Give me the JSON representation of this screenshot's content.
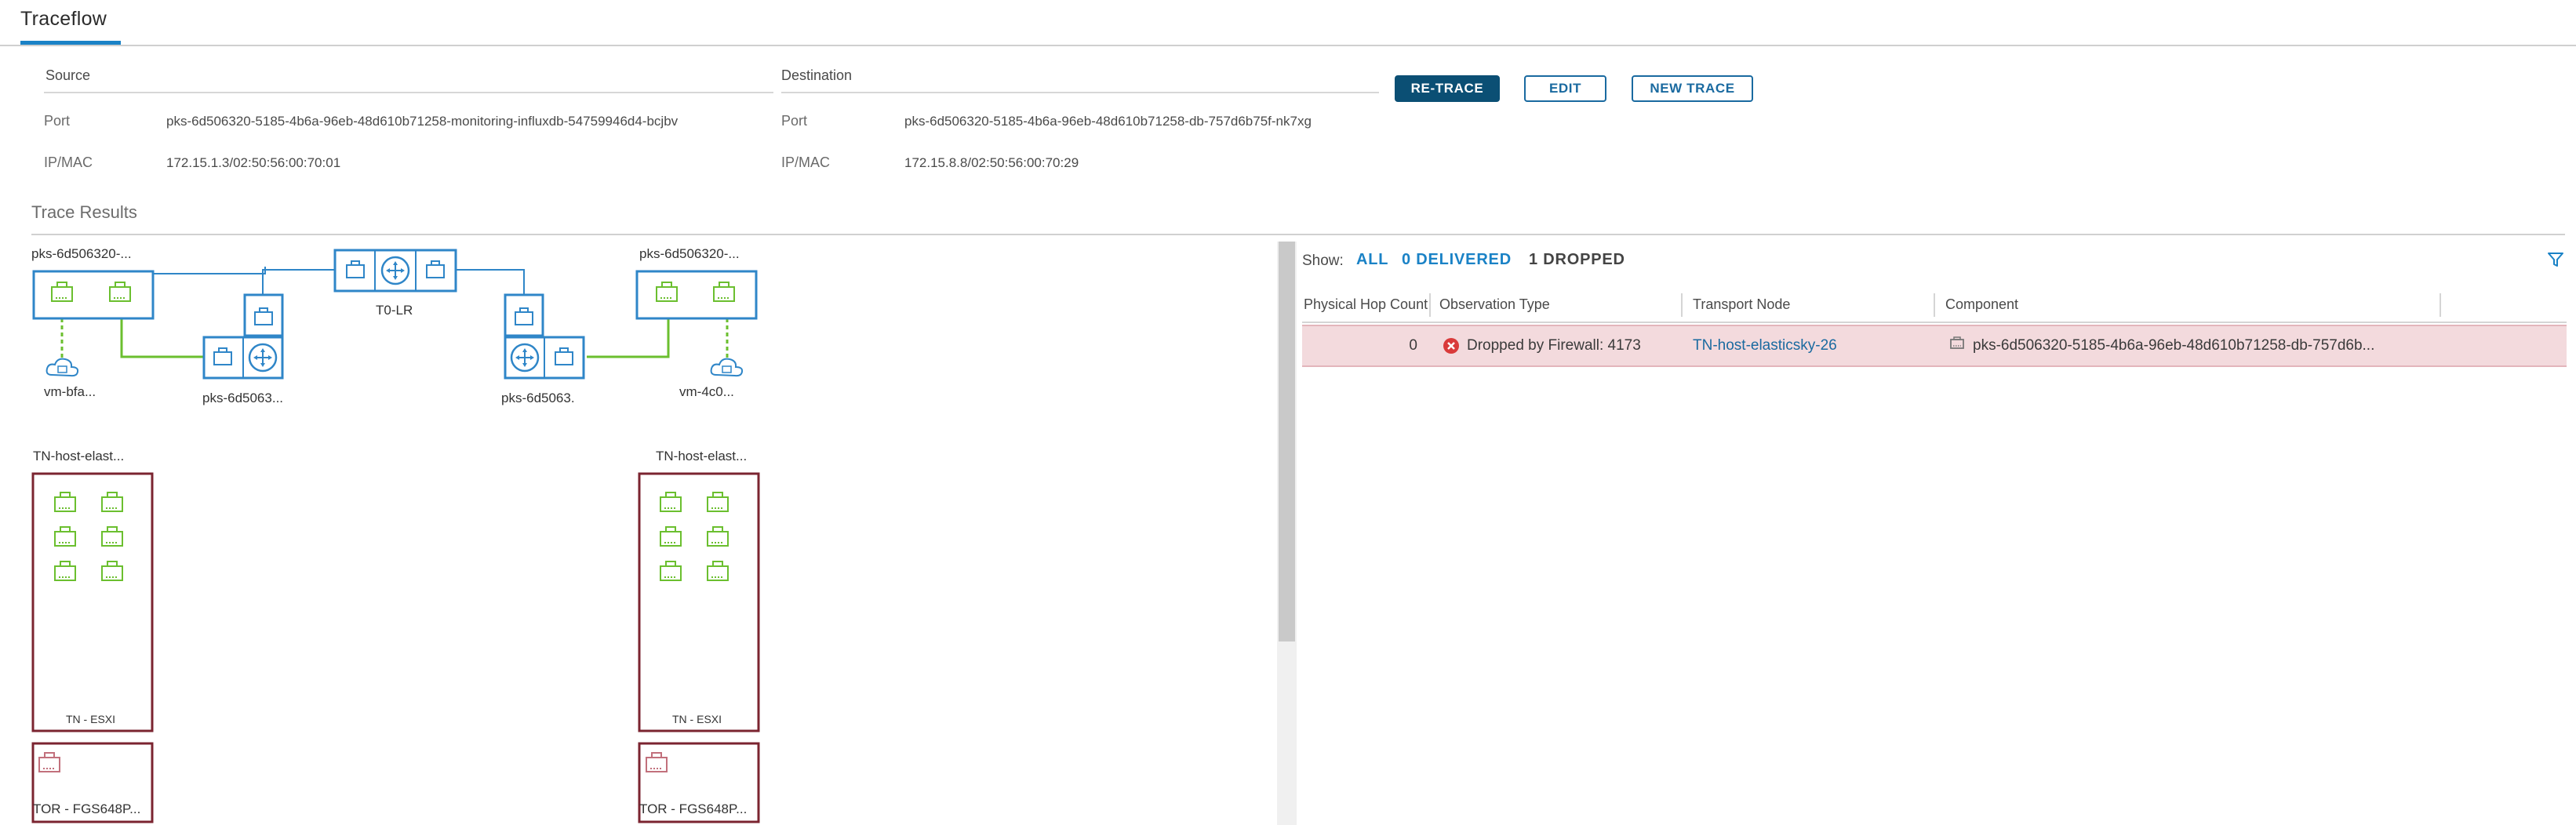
{
  "header": {
    "title": "Traceflow"
  },
  "source": {
    "section_label": "Source",
    "port_label": "Port",
    "port_value": "pks-6d506320-5185-4b6a-96eb-48d610b71258-monitoring-influxdb-54759946d4-bcjbv",
    "ipmac_label": "IP/MAC",
    "ipmac_value": "172.15.1.3/02:50:56:00:70:01"
  },
  "destination": {
    "section_label": "Destination",
    "port_label": "Port",
    "port_value": "pks-6d506320-5185-4b6a-96eb-48d610b71258-db-757d6b75f-nk7xg",
    "ipmac_label": "IP/MAC",
    "ipmac_value": "172.15.8.8/02:50:56:00:70:29"
  },
  "actions": {
    "retrace": "RE-TRACE",
    "edit": "EDIT",
    "new_trace": "NEW TRACE"
  },
  "results": {
    "title": "Trace Results",
    "topology": {
      "left_segment": "pks-6d506320-...",
      "right_segment": "pks-6d506320-...",
      "left_vm": "vm-bfa...",
      "right_vm": "vm-4c0...",
      "left_router": "pks-6d5063...",
      "right_router": "pks-6d5063.",
      "t0_router": "T0-LR",
      "left_host": "TN-host-elast...",
      "right_host": "TN-host-elast...",
      "left_esxi": "TN - ESXI",
      "right_esxi": "TN - ESXI",
      "left_tor": "TOR - FGS648P...",
      "right_tor": "TOR - FGS648P..."
    },
    "filters": {
      "show_label": "Show:",
      "all": "ALL",
      "delivered": "0 DELIVERED",
      "dropped": "1 DROPPED"
    },
    "table": {
      "columns": [
        "Physical Hop Count",
        "Observation Type",
        "Transport Node",
        "Component"
      ],
      "rows": [
        {
          "hop": "0",
          "observation": "Dropped by Firewall: 4173",
          "transport_node": "TN-host-elasticsky-26",
          "component": "pks-6d506320-5185-4b6a-96eb-48d610b71258-db-757d6b..."
        }
      ]
    }
  },
  "colors": {
    "accent": "#1a82c6",
    "primary_button": "#0b4f74",
    "host_border": "#7b2430",
    "segment_blue": "#2f86c8",
    "port_green": "#6bbf2f",
    "drop_red": "#d93a3a",
    "drop_row": "#f3dadd"
  }
}
